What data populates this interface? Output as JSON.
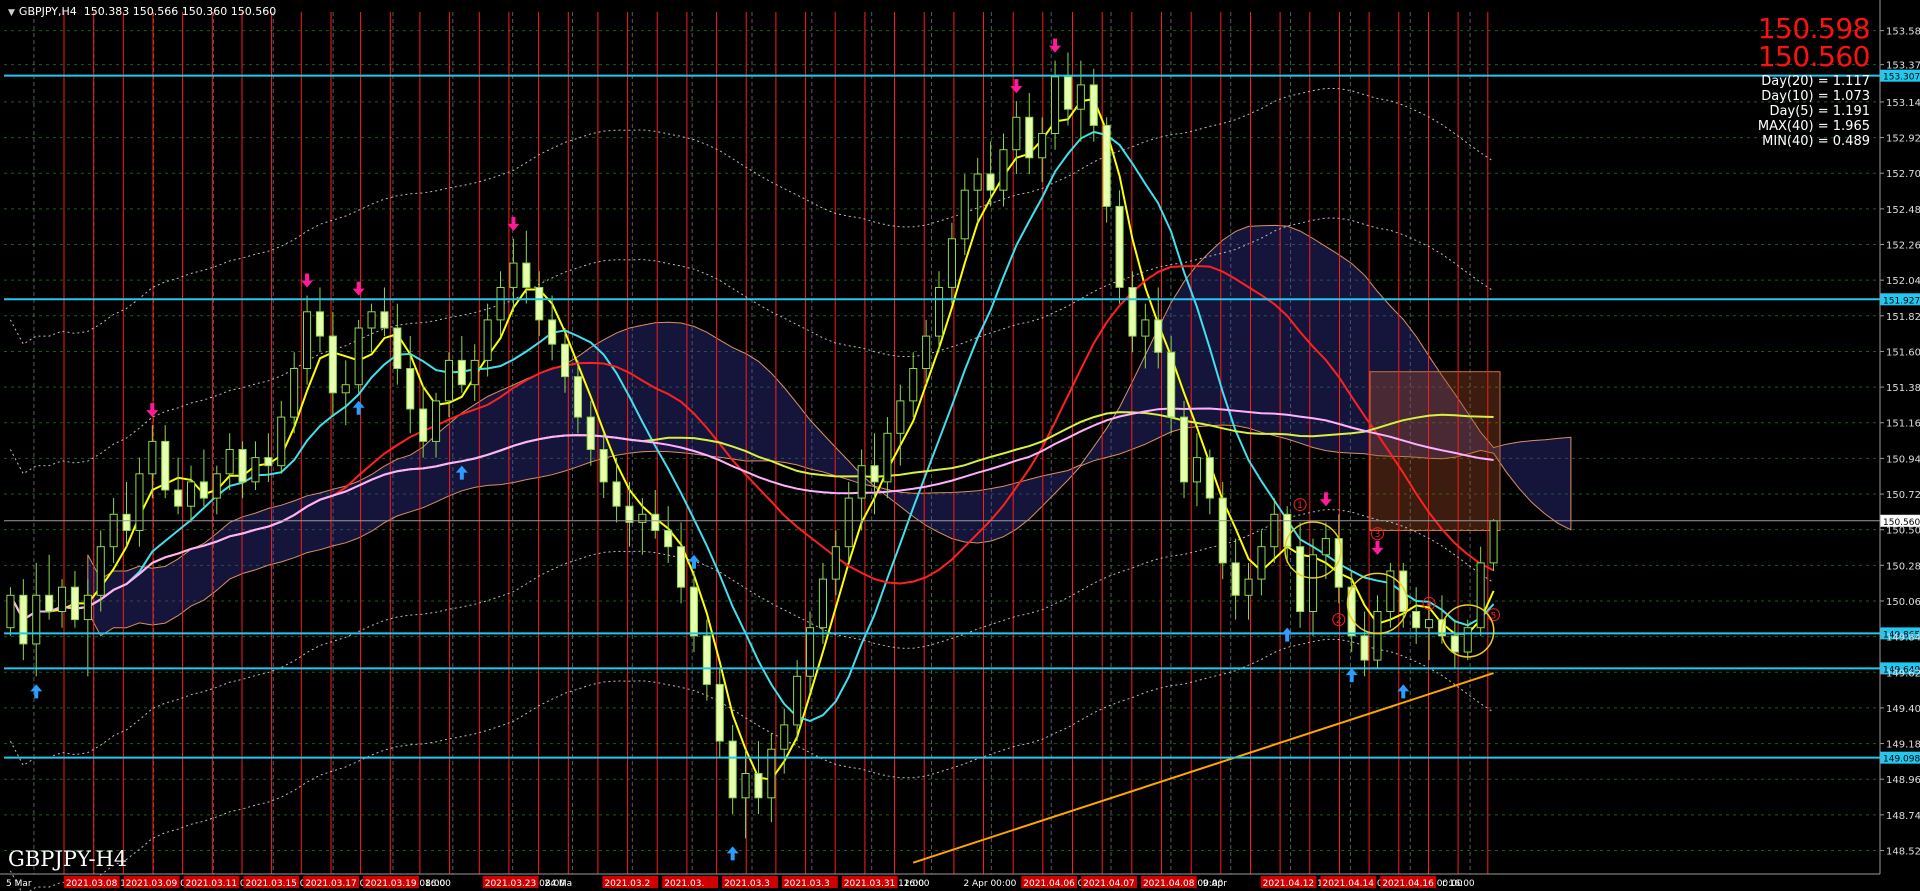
{
  "header": {
    "symbol": "GBPJPY,H4",
    "ohlc": "150.383 150.566 150.360 150.560"
  },
  "symbol_label": "GBPJPY-H4",
  "prices": {
    "bid": "150.598",
    "ask": "150.560"
  },
  "stats": [
    "Day(20) = 1.117",
    "Day(10) = 1.073",
    "Day(5) = 1.191",
    "MAX(40) = 1.965",
    "MIN(40) = 0.489"
  ],
  "colors": {
    "background": "#000000",
    "candle": "#8fd84a",
    "candle_body_up": "#000000",
    "candle_body_down": "#e8ffb0",
    "hline": "#22c8f0",
    "vline": "#ff1a1a",
    "ma_fast": "#ffff00",
    "ma_mid": "#40e0f0",
    "ma_slow": "#ff2020",
    "ma_long": "#d8f040",
    "ma_trend": "#ffb0ff",
    "ma_200": "#ffa500",
    "down_arrow": "#ff1a9a",
    "up_arrow": "#2a9dff"
  },
  "chart_data": {
    "type": "candlestick",
    "title": "GBPJPY,H4",
    "ylim": [
      148.38,
      153.7
    ],
    "y_ticks": [
      "153.585",
      "153.375",
      "153.145",
      "152.925",
      "152.705",
      "152.485",
      "152.265",
      "152.045",
      "151.825",
      "151.605",
      "151.385",
      "151.165",
      "150.945",
      "150.725",
      "150.505",
      "150.285",
      "150.065",
      "149.845",
      "149.625",
      "149.405",
      "149.185",
      "148.965",
      "148.745",
      "148.525"
    ],
    "y_tick_values": [
      153.585,
      153.375,
      153.145,
      152.925,
      152.705,
      152.485,
      152.265,
      152.045,
      151.825,
      151.605,
      151.385,
      151.165,
      150.945,
      150.725,
      150.505,
      150.285,
      150.065,
      149.845,
      149.625,
      149.405,
      149.185,
      148.965,
      148.745,
      148.525
    ],
    "horizontal_levels": [
      {
        "value": 153.307,
        "label": "153.307"
      },
      {
        "value": 151.927,
        "label": "151.927"
      },
      {
        "value": 149.865,
        "label": "149.865"
      },
      {
        "value": 149.649,
        "label": "149.649"
      },
      {
        "value": 149.098,
        "label": "149.098"
      }
    ],
    "current_price": {
      "value": 150.56,
      "label": "150.560"
    },
    "x_labels": [
      "5 Mar",
      "2021.03.08 1",
      "2021.03.09 08:00",
      "2021.03.11 0",
      "2021.03.15 0",
      "2021.03.17 00",
      "2021.03.19 08:00",
      "16:00",
      "2021.03.23 08:00",
      "24 Ma",
      "2021.03.2",
      "2021.03.",
      "2021.03.3",
      "2021.03.3",
      "2021.03.31 12:00",
      "16:00",
      "2 Apr 00:00",
      "2021.04.06 00:00",
      "2021.04.07",
      "2021.04.08 00:00",
      "9 Apr",
      "2021.04.12 12:00",
      "2021.04.14 08:00",
      "2021.04.16 00:00",
      "r 16:00"
    ],
    "x_label_highlight": [
      false,
      true,
      true,
      true,
      true,
      true,
      true,
      false,
      true,
      false,
      true,
      true,
      true,
      true,
      true,
      false,
      false,
      true,
      true,
      true,
      false,
      true,
      true,
      true,
      false
    ],
    "candles": [
      [
        149.9,
        150.15,
        149.85,
        150.1
      ],
      [
        150.1,
        150.2,
        149.7,
        149.8
      ],
      [
        149.8,
        150.3,
        149.6,
        150.1
      ],
      [
        150.1,
        150.35,
        149.95,
        150.0
      ],
      [
        150.0,
        150.2,
        149.9,
        150.15
      ],
      [
        150.15,
        150.25,
        149.9,
        149.95
      ],
      [
        149.95,
        150.2,
        149.6,
        150.1
      ],
      [
        150.1,
        150.5,
        150.0,
        150.4
      ],
      [
        150.4,
        150.7,
        150.3,
        150.6
      ],
      [
        150.6,
        150.8,
        150.4,
        150.5
      ],
      [
        150.5,
        150.95,
        150.4,
        150.85
      ],
      [
        150.85,
        151.15,
        150.7,
        151.05
      ],
      [
        151.05,
        151.15,
        150.7,
        150.75
      ],
      [
        150.75,
        150.95,
        150.6,
        150.65
      ],
      [
        150.65,
        150.9,
        150.55,
        150.8
      ],
      [
        150.8,
        151.0,
        150.65,
        150.7
      ],
      [
        150.7,
        150.9,
        150.6,
        150.85
      ],
      [
        150.85,
        151.1,
        150.75,
        151.0
      ],
      [
        151.0,
        151.05,
        150.7,
        150.8
      ],
      [
        150.8,
        151.05,
        150.75,
        150.95
      ],
      [
        150.95,
        151.1,
        150.8,
        150.9
      ],
      [
        150.9,
        151.3,
        150.85,
        151.2
      ],
      [
        151.2,
        151.6,
        151.1,
        151.5
      ],
      [
        151.5,
        151.95,
        151.4,
        151.85
      ],
      [
        151.85,
        152.0,
        151.6,
        151.7
      ],
      [
        151.7,
        151.85,
        151.2,
        151.35
      ],
      [
        151.35,
        151.55,
        151.15,
        151.4
      ],
      [
        151.4,
        151.8,
        151.35,
        151.75
      ],
      [
        151.75,
        151.9,
        151.6,
        151.85
      ],
      [
        151.85,
        152.0,
        151.7,
        151.75
      ],
      [
        151.75,
        151.9,
        151.4,
        151.5
      ],
      [
        151.5,
        151.7,
        151.1,
        151.25
      ],
      [
        151.25,
        151.4,
        150.95,
        151.05
      ],
      [
        151.05,
        151.35,
        150.95,
        151.3
      ],
      [
        151.3,
        151.6,
        151.2,
        151.55
      ],
      [
        151.55,
        151.7,
        151.35,
        151.4
      ],
      [
        151.4,
        151.65,
        151.3,
        151.55
      ],
      [
        151.55,
        151.9,
        151.45,
        151.8
      ],
      [
        151.8,
        152.1,
        151.7,
        152.0
      ],
      [
        152.0,
        152.3,
        151.85,
        152.15
      ],
      [
        152.15,
        152.35,
        151.9,
        152.0
      ],
      [
        152.0,
        152.1,
        151.7,
        151.8
      ],
      [
        151.8,
        151.95,
        151.55,
        151.65
      ],
      [
        151.65,
        151.75,
        151.35,
        151.45
      ],
      [
        151.45,
        151.55,
        151.1,
        151.2
      ],
      [
        151.2,
        151.3,
        150.9,
        151.0
      ],
      [
        151.0,
        151.1,
        150.7,
        150.8
      ],
      [
        150.8,
        150.95,
        150.55,
        150.65
      ],
      [
        150.65,
        150.8,
        150.4,
        150.55
      ],
      [
        150.55,
        150.7,
        150.35,
        150.6
      ],
      [
        150.6,
        150.75,
        150.45,
        150.5
      ],
      [
        150.5,
        150.65,
        150.3,
        150.4
      ],
      [
        150.4,
        150.55,
        150.05,
        150.15
      ],
      [
        150.15,
        150.25,
        149.75,
        149.85
      ],
      [
        149.85,
        149.95,
        149.45,
        149.55
      ],
      [
        149.55,
        149.65,
        149.1,
        149.2
      ],
      [
        149.2,
        149.3,
        148.75,
        148.85
      ],
      [
        148.85,
        149.15,
        148.6,
        149.0
      ],
      [
        149.0,
        149.2,
        148.75,
        148.85
      ],
      [
        148.85,
        149.25,
        148.7,
        149.15
      ],
      [
        149.15,
        149.4,
        149.0,
        149.3
      ],
      [
        149.3,
        149.7,
        149.2,
        149.6
      ],
      [
        149.6,
        150.0,
        149.5,
        149.9
      ],
      [
        149.9,
        150.3,
        149.8,
        150.2
      ],
      [
        150.2,
        150.5,
        150.1,
        150.4
      ],
      [
        150.4,
        150.8,
        150.3,
        150.7
      ],
      [
        150.7,
        151.0,
        150.5,
        150.9
      ],
      [
        150.9,
        151.1,
        150.6,
        150.8
      ],
      [
        150.8,
        151.2,
        150.7,
        151.1
      ],
      [
        151.1,
        151.4,
        150.9,
        151.3
      ],
      [
        151.3,
        151.6,
        151.2,
        151.5
      ],
      [
        151.5,
        151.8,
        151.4,
        151.7
      ],
      [
        151.7,
        152.1,
        151.6,
        152.0
      ],
      [
        152.0,
        152.4,
        151.9,
        152.3
      ],
      [
        152.3,
        152.7,
        152.2,
        152.6
      ],
      [
        152.6,
        152.8,
        152.4,
        152.7
      ],
      [
        152.7,
        152.9,
        152.5,
        152.6
      ],
      [
        152.6,
        152.95,
        152.5,
        152.85
      ],
      [
        152.85,
        153.15,
        152.7,
        153.05
      ],
      [
        153.05,
        153.2,
        152.7,
        152.8
      ],
      [
        152.8,
        153.05,
        152.65,
        152.95
      ],
      [
        152.95,
        153.4,
        152.85,
        153.3
      ],
      [
        153.3,
        153.45,
        153.0,
        153.1
      ],
      [
        153.1,
        153.4,
        152.9,
        153.25
      ],
      [
        153.25,
        153.35,
        152.9,
        153.0
      ],
      [
        153.0,
        153.05,
        152.4,
        152.5
      ],
      [
        152.5,
        152.6,
        151.9,
        152.0
      ],
      [
        152.0,
        152.1,
        151.6,
        151.7
      ],
      [
        151.7,
        151.9,
        151.5,
        151.8
      ],
      [
        151.8,
        152.0,
        151.5,
        151.6
      ],
      [
        151.6,
        151.7,
        151.1,
        151.2
      ],
      [
        151.2,
        151.3,
        150.7,
        150.8
      ],
      [
        150.8,
        151.1,
        150.65,
        150.95
      ],
      [
        150.95,
        151.0,
        150.6,
        150.7
      ],
      [
        150.7,
        150.8,
        150.2,
        150.3
      ],
      [
        150.3,
        150.45,
        149.95,
        150.1
      ],
      [
        150.1,
        150.3,
        149.95,
        150.2
      ],
      [
        150.2,
        150.5,
        150.1,
        150.4
      ],
      [
        150.4,
        150.7,
        150.3,
        150.6
      ],
      [
        150.6,
        150.65,
        150.3,
        150.4
      ],
      [
        150.4,
        150.55,
        149.9,
        150.0
      ],
      [
        150.0,
        150.45,
        149.85,
        150.35
      ],
      [
        150.35,
        150.55,
        150.2,
        150.45
      ],
      [
        150.45,
        150.6,
        150.05,
        150.15
      ],
      [
        150.15,
        150.25,
        149.75,
        149.85
      ],
      [
        149.85,
        150.0,
        149.6,
        149.7
      ],
      [
        149.7,
        150.1,
        149.65,
        150.0
      ],
      [
        150.0,
        150.3,
        149.9,
        150.25
      ],
      [
        150.25,
        150.3,
        149.9,
        150.0
      ],
      [
        150.0,
        150.15,
        149.8,
        149.9
      ],
      [
        149.9,
        150.05,
        149.7,
        149.95
      ],
      [
        149.95,
        150.1,
        149.8,
        149.85
      ],
      [
        149.85,
        149.95,
        149.65,
        149.75
      ],
      [
        149.75,
        149.95,
        149.7,
        149.9
      ],
      [
        149.9,
        150.4,
        149.85,
        150.3
      ],
      [
        150.3,
        150.57,
        150.25,
        150.56
      ]
    ],
    "down_arrows": [
      {
        "i": 11,
        "v": 151.15
      },
      {
        "i": 23,
        "v": 151.95
      },
      {
        "i": 27,
        "v": 151.9
      },
      {
        "i": 39,
        "v": 152.3
      },
      {
        "i": 81,
        "v": 153.4
      },
      {
        "i": 78,
        "v": 153.15
      },
      {
        "i": 102,
        "v": 150.6
      },
      {
        "i": 106,
        "v": 150.3
      }
    ],
    "up_arrows": [
      {
        "i": 2,
        "v": 149.6
      },
      {
        "i": 27,
        "v": 151.35
      },
      {
        "i": 35,
        "v": 150.95
      },
      {
        "i": 53,
        "v": 150.4
      },
      {
        "i": 56,
        "v": 148.6
      },
      {
        "i": 99,
        "v": 149.95
      },
      {
        "i": 104,
        "v": 149.7
      },
      {
        "i": 108,
        "v": 149.6
      }
    ],
    "wave_labels": [
      "1",
      "2",
      "3",
      "4",
      "5"
    ]
  }
}
